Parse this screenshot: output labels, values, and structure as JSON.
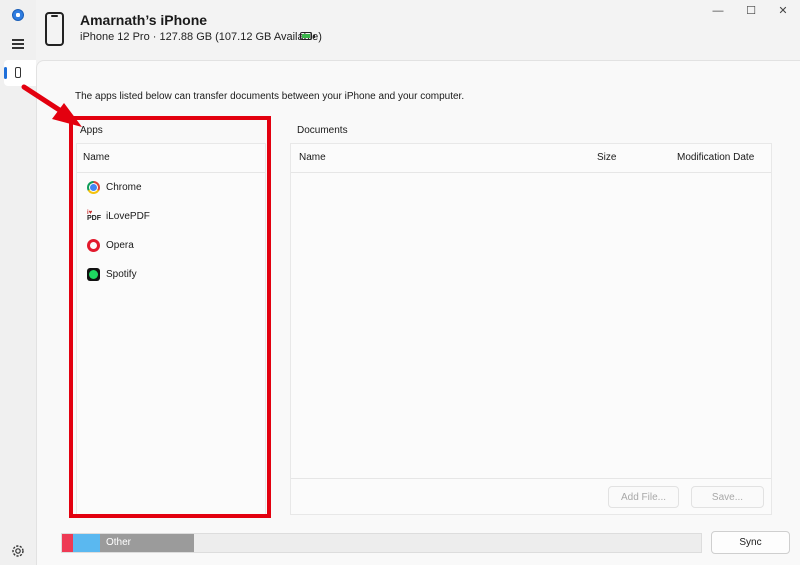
{
  "device": {
    "name": "Amarnath’s iPhone",
    "details": "iPhone 12 Pro · 127.88 GB (107.12 GB Available)",
    "battery_level": 1.0
  },
  "window_controls": {
    "minimize": "—",
    "maximize": "☐",
    "close": "✕"
  },
  "intro_text": "The apps listed below can transfer documents between your iPhone and your computer.",
  "apps_panel": {
    "label": "Apps",
    "column_name": "Name",
    "items": [
      {
        "name": "Chrome",
        "icon": "chrome-icon"
      },
      {
        "name": "iLovePDF",
        "icon": "ilovepdf-icon",
        "icon_text_top": "i♥",
        "icon_text_bottom": "PDF"
      },
      {
        "name": "Opera",
        "icon": "opera-icon"
      },
      {
        "name": "Spotify",
        "icon": "spotify-icon"
      }
    ]
  },
  "documents_panel": {
    "label": "Documents",
    "columns": [
      "Name",
      "Size",
      "Modification Date"
    ],
    "add_file_label": "Add File...",
    "save_label": "Save..."
  },
  "storage_bar": {
    "segment_label": "Other",
    "colors": {
      "red": "#ee3a54",
      "blue": "#5ab8f0",
      "gray": "#9b9b9b"
    }
  },
  "sync_label": "Sync",
  "annotation": {
    "highlight_color": "#e3000f"
  }
}
